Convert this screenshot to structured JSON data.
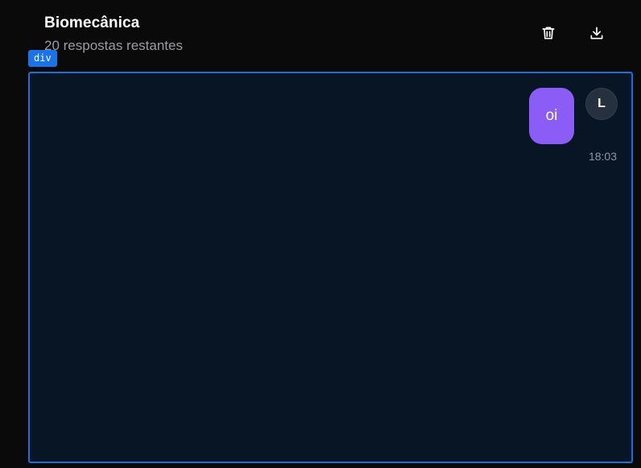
{
  "header": {
    "title": "Biomecânica",
    "subtitle": "20 respostas restantes",
    "actions": [
      {
        "icon": "trash-icon"
      },
      {
        "icon": "download-icon"
      }
    ]
  },
  "devtools": {
    "tag": "div"
  },
  "chat": {
    "messages": [
      {
        "text": "oi",
        "avatar_initial": "L",
        "time": "18:03",
        "bubble_color": "#8b5cf6"
      }
    ]
  },
  "colors": {
    "background": "#0a0a0b",
    "chat_background": "#081524",
    "highlight_border": "#1b6fd6",
    "accent": "#8b5cf6"
  }
}
